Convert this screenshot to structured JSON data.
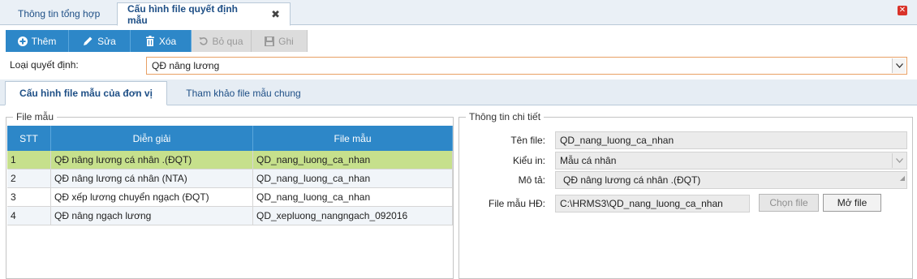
{
  "tabs": [
    {
      "label": "Thông tin tổng hợp"
    },
    {
      "label": "Cấu hình file quyết định mẫu",
      "close": "✖"
    }
  ],
  "window_close": "✕",
  "toolbar": {
    "add": "Thêm",
    "edit": "Sửa",
    "delete": "Xóa",
    "skip": "Bỏ qua",
    "save": "Ghi"
  },
  "decision_type": {
    "label": "Loại quyết định:",
    "value": "QĐ nâng lương"
  },
  "subtabs": [
    {
      "label": "Cấu hình file mẫu của đơn vị"
    },
    {
      "label": "Tham khảo file mẫu chung"
    }
  ],
  "file_list": {
    "legend": "File mẫu",
    "columns": [
      "STT",
      "Diễn giải",
      "File mẫu"
    ],
    "rows": [
      {
        "stt": "1",
        "desc": "QĐ nâng lương cá nhân .(ĐQT)",
        "file": "QD_nang_luong_ca_nhan"
      },
      {
        "stt": "2",
        "desc": "QĐ nâng lương cá nhân (NTA)",
        "file": "QD_nang_luong_ca_nhan"
      },
      {
        "stt": "3",
        "desc": "QĐ xếp lương chuyển ngạch (ĐQT)",
        "file": "QD_nang_luong_ca_nhan"
      },
      {
        "stt": "4",
        "desc": "QĐ nâng ngạch lương",
        "file": "QD_xepluong_nangngach_092016"
      }
    ]
  },
  "detail": {
    "legend": "Thông tin chi tiết",
    "file_name_label": "Tên file:",
    "file_name": "QD_nang_luong_ca_nhan",
    "print_type_label": "Kiểu in:",
    "print_type": "Mẫu cá nhân",
    "desc_label": "Mô tả:",
    "desc": "QĐ nâng lương cá nhân .(ĐQT)",
    "template_label": "File mẫu HĐ:",
    "template_path": "C:\\HRMS3\\QD_nang_luong_ca_nhan",
    "choose_file": "Chọn file",
    "open_file": "Mở file"
  },
  "colors": {
    "accent": "#2d87c8",
    "selected_row": "#c6e08c",
    "input_border_focus": "#e8a065"
  }
}
